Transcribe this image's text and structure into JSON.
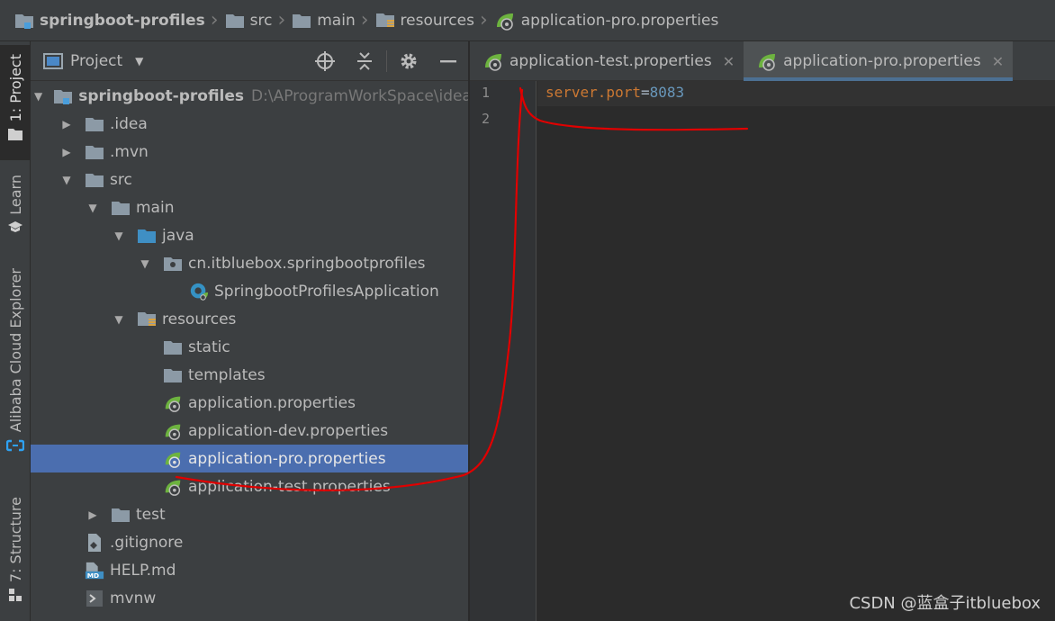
{
  "breadcrumb": [
    {
      "label": "springboot-profiles",
      "icon": "module-folder-icon"
    },
    {
      "label": "src",
      "icon": "folder-icon"
    },
    {
      "label": "main",
      "icon": "folder-icon"
    },
    {
      "label": "resources",
      "icon": "resources-folder-icon"
    },
    {
      "label": "application-pro.properties",
      "icon": "spring-properties-icon"
    }
  ],
  "tool_stripe": {
    "project": "1: Project",
    "learn": "Learn",
    "alibaba": "Alibaba Cloud Explorer",
    "structure": "7: Structure"
  },
  "project_panel": {
    "title": "Project",
    "tree": [
      {
        "label": "springboot-profiles",
        "hint": "D:\\AProgramWorkSpace\\idea\\s",
        "icon": "module-folder-icon",
        "arrow": "expanded"
      },
      {
        "label": ".idea",
        "icon": "folder-icon",
        "arrow": "collapsed"
      },
      {
        "label": ".mvn",
        "icon": "folder-icon",
        "arrow": "collapsed"
      },
      {
        "label": "src",
        "icon": "folder-icon",
        "arrow": "expanded"
      },
      {
        "label": "main",
        "icon": "folder-icon",
        "arrow": "expanded"
      },
      {
        "label": "java",
        "icon": "source-folder-icon",
        "arrow": "expanded"
      },
      {
        "label": "cn.itbluebox.springbootprofiles",
        "icon": "package-icon",
        "arrow": "expanded"
      },
      {
        "label": "SpringbootProfilesApplication",
        "icon": "spring-boot-class-icon",
        "arrow": "none"
      },
      {
        "label": "resources",
        "icon": "resources-folder-icon",
        "arrow": "expanded"
      },
      {
        "label": "static",
        "icon": "folder-icon",
        "arrow": "none"
      },
      {
        "label": "templates",
        "icon": "folder-icon",
        "arrow": "none"
      },
      {
        "label": "application.properties",
        "icon": "spring-properties-icon",
        "arrow": "none"
      },
      {
        "label": "application-dev.properties",
        "icon": "spring-properties-icon",
        "arrow": "none"
      },
      {
        "label": "application-pro.properties",
        "icon": "spring-properties-icon",
        "arrow": "none",
        "selected": true
      },
      {
        "label": "application-test.properties",
        "icon": "spring-properties-icon",
        "arrow": "none"
      },
      {
        "label": "test",
        "icon": "folder-icon",
        "arrow": "collapsed"
      },
      {
        "label": ".gitignore",
        "icon": "gitignore-file-icon",
        "arrow": "none"
      },
      {
        "label": "HELP.md",
        "icon": "markdown-file-icon",
        "arrow": "none"
      },
      {
        "label": "mvnw",
        "icon": "shell-script-icon",
        "arrow": "none"
      }
    ]
  },
  "editor": {
    "tabs": [
      {
        "label": "application-test.properties",
        "active": false
      },
      {
        "label": "application-pro.properties",
        "active": true
      }
    ],
    "line_numbers": [
      "1",
      "2"
    ],
    "code": {
      "key": "server.port",
      "eq": "=",
      "value": "8083"
    }
  },
  "watermark": "CSDN @蓝盒子itbluebox",
  "colors": {
    "selection": "#4b6eaf",
    "annotation": "#e00000",
    "spring_green": "#6db33f"
  }
}
